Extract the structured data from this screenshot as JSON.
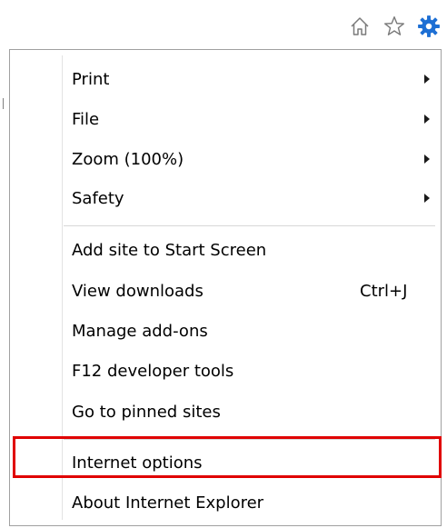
{
  "toolbar": {
    "icons": [
      "home-icon",
      "favorites-star-icon",
      "tools-gear-icon"
    ],
    "gear_color": "#1d6fd4"
  },
  "menu": {
    "items": [
      {
        "label": "Print",
        "submenu": true
      },
      {
        "label": "File",
        "submenu": true
      },
      {
        "label": "Zoom (100%)",
        "submenu": true
      },
      {
        "label": "Safety",
        "submenu": true
      },
      {
        "label": "Add site to Start Screen"
      },
      {
        "label": "View downloads",
        "shortcut": "Ctrl+J"
      },
      {
        "label": "Manage add-ons"
      },
      {
        "label": "F12 developer tools"
      },
      {
        "label": "Go to pinned sites"
      },
      {
        "label": "Internet options",
        "highlighted": true
      },
      {
        "label": "About Internet Explorer"
      }
    ]
  },
  "colors": {
    "highlight_border": "#e00000"
  }
}
